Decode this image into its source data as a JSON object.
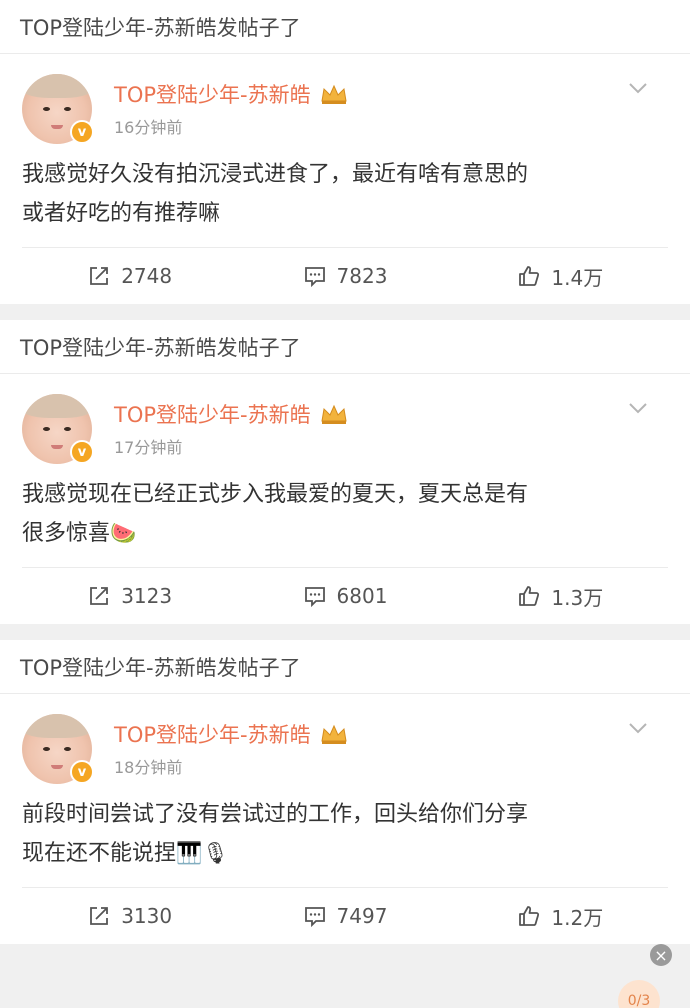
{
  "posts": [
    {
      "section_title": "TOP登陆少年-苏新皓发帖子了",
      "author": "TOP登陆少年-苏新皓",
      "time": "16分钟前",
      "lines": [
        "我感觉好久没有拍沉浸式进食了，最近有啥有意思的",
        "或者好吃的有推荐嘛"
      ],
      "emoji": "",
      "reposts": "2748",
      "comments": "7823",
      "likes": "1.4万"
    },
    {
      "section_title": "TOP登陆少年-苏新皓发帖子了",
      "author": "TOP登陆少年-苏新皓",
      "time": "17分钟前",
      "lines": [
        "我感觉现在已经正式步入我最爱的夏天，夏天总是有",
        "很多惊喜"
      ],
      "emoji": "🍉",
      "reposts": "3123",
      "comments": "6801",
      "likes": "1.3万"
    },
    {
      "section_title": "TOP登陆少年-苏新皓发帖子了",
      "author": "TOP登陆少年-苏新皓",
      "time": "18分钟前",
      "lines": [
        "前段时间尝试了没有尝试过的工作，回头给你们分享",
        "现在还不能说捏"
      ],
      "emoji": "🎹🎙",
      "reposts": "3130",
      "comments": "7497",
      "likes": "1.2万"
    }
  ],
  "verified_badge": "v",
  "floating_badge": {
    "close": "×",
    "progress": "0/3"
  },
  "icons": {
    "repost": "repost-icon",
    "comment": "comment-icon",
    "like": "thumbs-up-icon",
    "more": "chevron-down-icon",
    "vip": "crown-icon"
  },
  "colors": {
    "name": "#eb7350",
    "badge": "#f5a623",
    "text": "#333333",
    "meta": "#999999"
  }
}
